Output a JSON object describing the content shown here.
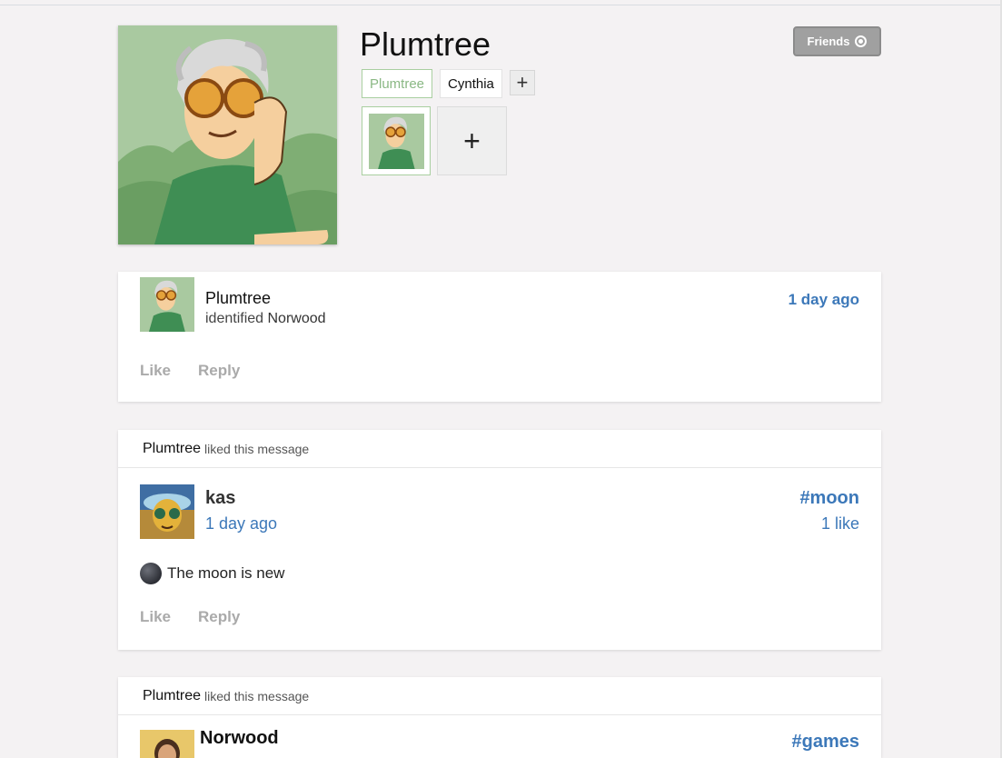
{
  "profile": {
    "name": "Plumtree",
    "friends_label": "Friends",
    "name_tabs": [
      {
        "label": "Plumtree",
        "active": true
      },
      {
        "label": "Cynthia",
        "active": false
      }
    ],
    "add_name_label": "+",
    "add_photo_label": "+"
  },
  "feed": {
    "items": [
      {
        "author": "Plumtree",
        "action": "identified",
        "target": "Norwood",
        "time": "1 day ago",
        "like_label": "Like",
        "reply_label": "Reply"
      },
      {
        "liked_by": "Plumtree",
        "liked_text": "liked this message",
        "author": "kas",
        "time": "1 day ago",
        "tag": "#moon",
        "likes": "1 like",
        "body": "The moon is new",
        "like_label": "Like",
        "reply_label": "Reply"
      },
      {
        "liked_by": "Plumtree",
        "liked_text": "liked this message",
        "author": "Norwood",
        "tag": "#games"
      }
    ]
  }
}
